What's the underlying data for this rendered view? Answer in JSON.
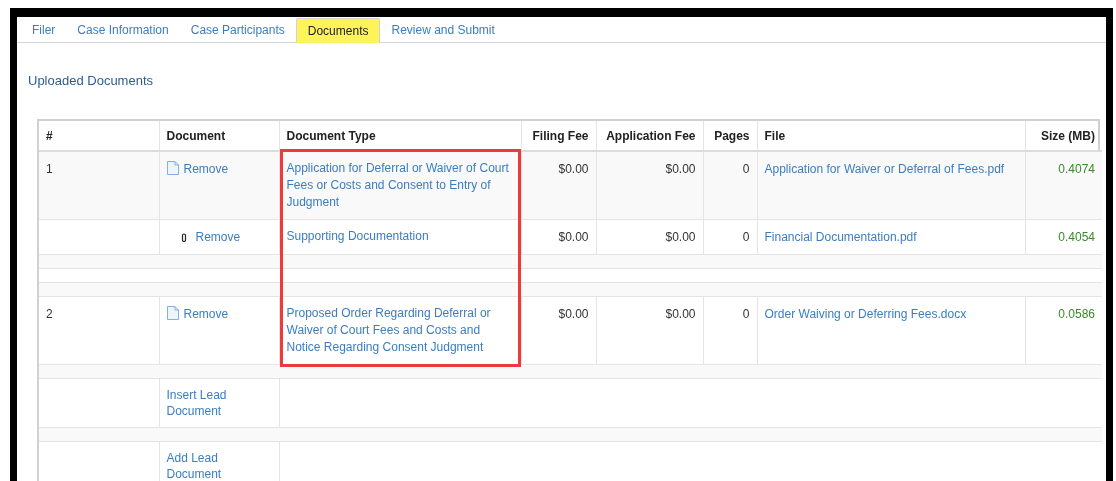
{
  "tabs": [
    {
      "label": "Filer",
      "selected": false
    },
    {
      "label": "Case Information",
      "selected": false
    },
    {
      "label": "Case Participants",
      "selected": false
    },
    {
      "label": "Documents",
      "selected": true
    },
    {
      "label": "Review and Submit",
      "selected": false
    }
  ],
  "section_title": "Uploaded Documents",
  "table": {
    "columns": [
      "#",
      "Document",
      "Document Type",
      "Filing Fee",
      "Application Fee",
      "Pages",
      "File",
      "Size (MB)"
    ],
    "rows": [
      {
        "kind": "lead",
        "number": "1",
        "action": "Remove",
        "document_type": "Application for Deferral or Waiver of Court Fees or Costs and Consent to Entry of Judgment",
        "highlighted": true,
        "filing_fee": "$0.00",
        "application_fee": "$0.00",
        "pages": "0",
        "file": "Application for Waiver or Deferral of Fees.pdf",
        "size": "0.4074"
      },
      {
        "kind": "attachment",
        "action": "Remove",
        "document_type": "Supporting Documentation",
        "highlighted": true,
        "filing_fee": "$0.00",
        "application_fee": "$0.00",
        "pages": "0",
        "file": "Financial Documentation.pdf",
        "size": "0.4054"
      },
      {
        "kind": "spacer"
      },
      {
        "kind": "spacer"
      },
      {
        "kind": "spacer"
      },
      {
        "kind": "lead",
        "number": "2",
        "action": "Remove",
        "document_type": "Proposed Order Regarding Deferral or Waiver of Court Fees and Costs and Notice Regarding Consent Judgment",
        "highlighted": true,
        "filing_fee": "$0.00",
        "application_fee": "$0.00",
        "pages": "0",
        "file": "Order Waiving or Deferring Fees.docx",
        "size": "0.0586"
      },
      {
        "kind": "spacer"
      },
      {
        "kind": "link",
        "action": "Insert Lead Document"
      },
      {
        "kind": "spacer"
      },
      {
        "kind": "link",
        "action": "Add Lead Document"
      }
    ]
  }
}
